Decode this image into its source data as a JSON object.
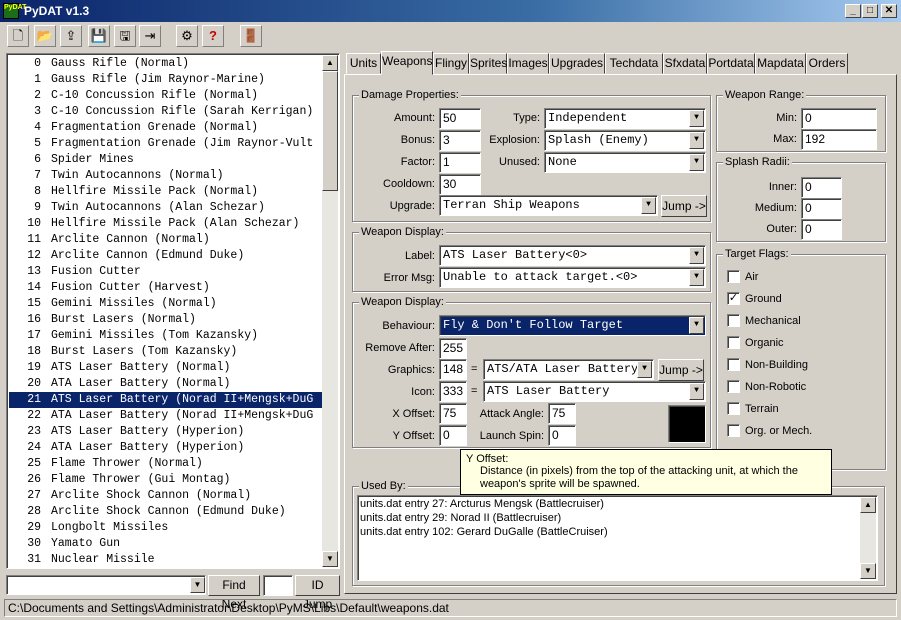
{
  "window": {
    "title": "PyDAT v1.3",
    "app_icon_text": "PyDAT"
  },
  "window_buttons": {
    "minimize": "_",
    "maximize": "□",
    "close": "✕"
  },
  "toolbar": {
    "new": "🗋",
    "open": "📂",
    "import": "⇪",
    "save": "💾",
    "save_as": "🖫",
    "export": "⇥",
    "settings": "⚙",
    "help": "?",
    "exit": "🚪"
  },
  "entries": [
    {
      "id": "0",
      "name": "Gauss Rifle (Normal)"
    },
    {
      "id": "1",
      "name": "Gauss Rifle (Jim Raynor-Marine)"
    },
    {
      "id": "2",
      "name": "C-10 Concussion Rifle (Normal)"
    },
    {
      "id": "3",
      "name": "C-10 Concussion Rifle (Sarah Kerrigan)"
    },
    {
      "id": "4",
      "name": "Fragmentation Grenade (Normal)"
    },
    {
      "id": "5",
      "name": "Fragmentation Grenade (Jim Raynor-Vult"
    },
    {
      "id": "6",
      "name": "Spider Mines"
    },
    {
      "id": "7",
      "name": "Twin Autocannons (Normal)"
    },
    {
      "id": "8",
      "name": "Hellfire Missile Pack (Normal)"
    },
    {
      "id": "9",
      "name": "Twin Autocannons (Alan Schezar)"
    },
    {
      "id": "10",
      "name": "Hellfire Missile Pack (Alan Schezar)"
    },
    {
      "id": "11",
      "name": "Arclite Cannon (Normal)"
    },
    {
      "id": "12",
      "name": "Arclite Cannon (Edmund Duke)"
    },
    {
      "id": "13",
      "name": "Fusion Cutter"
    },
    {
      "id": "14",
      "name": "Fusion Cutter (Harvest)"
    },
    {
      "id": "15",
      "name": "Gemini Missiles (Normal)"
    },
    {
      "id": "16",
      "name": "Burst Lasers (Normal)"
    },
    {
      "id": "17",
      "name": "Gemini Missiles (Tom Kazansky)"
    },
    {
      "id": "18",
      "name": "Burst Lasers (Tom Kazansky)"
    },
    {
      "id": "19",
      "name": "ATS Laser Battery (Normal)"
    },
    {
      "id": "20",
      "name": "ATA Laser Battery (Normal)"
    },
    {
      "id": "21",
      "name": "ATS Laser Battery (Norad II+Mengsk+DuG"
    },
    {
      "id": "22",
      "name": "ATA Laser Battery (Norad II+Mengsk+DuG"
    },
    {
      "id": "23",
      "name": "ATS Laser Battery (Hyperion)"
    },
    {
      "id": "24",
      "name": "ATA Laser Battery (Hyperion)"
    },
    {
      "id": "25",
      "name": "Flame Thrower (Normal)"
    },
    {
      "id": "26",
      "name": "Flame Thrower (Gui Montag)"
    },
    {
      "id": "27",
      "name": "Arclite Shock Cannon (Normal)"
    },
    {
      "id": "28",
      "name": "Arclite Shock Cannon (Edmund Duke)"
    },
    {
      "id": "29",
      "name": "Longbolt Missiles"
    },
    {
      "id": "30",
      "name": "Yamato Gun"
    },
    {
      "id": "31",
      "name": "Nuclear Missile"
    }
  ],
  "selected_index": 21,
  "bottom_bar": {
    "find_value": "",
    "find_next": "Find Next",
    "id_value": "",
    "id_jump": "ID Jump"
  },
  "tabs": [
    "Units",
    "Weapons",
    "Flingy",
    "Sprites",
    "Images",
    "Upgrades",
    "Techdata",
    "Sfxdata",
    "Portdata",
    "Mapdata",
    "Orders"
  ],
  "active_tab": "Weapons",
  "damage": {
    "title": "Damage Properties:",
    "amount_label": "Amount:",
    "amount": "50",
    "bonus_label": "Bonus:",
    "bonus": "3",
    "factor_label": "Factor:",
    "factor": "1",
    "cooldown_label": "Cooldown:",
    "cooldown": "30",
    "upgrade_label": "Upgrade:",
    "upgrade": "Terran Ship Weapons",
    "type_label": "Type:",
    "type": "Independent",
    "explosion_label": "Explosion:",
    "explosion": "Splash (Enemy)",
    "unused_label": "Unused:",
    "unused": "None",
    "jump": "Jump ->"
  },
  "display1": {
    "title": "Weapon Display:",
    "label_label": "Label:",
    "label": "ATS Laser Battery<0>",
    "error_label": "Error Msg:",
    "error": "Unable to attack target.<0>"
  },
  "display2": {
    "title": "Weapon Display:",
    "behaviour_label": "Behaviour:",
    "behaviour": "Fly & Don't Follow Target",
    "remove_label": "Remove After:",
    "remove": "255",
    "graphics_label": "Graphics:",
    "graphics": "148",
    "graphics_name": "ATS/ATA Laser Battery",
    "icon_label": "Icon:",
    "icon": "333",
    "icon_name": "ATS Laser Battery",
    "xoff_label": "X Offset:",
    "xoff": "75",
    "yoff_label": "Y Offset:",
    "yoff": "0",
    "angle_label": "Attack Angle:",
    "angle": "75",
    "spin_label": "Launch Spin:",
    "spin": "0",
    "eq": "=",
    "jump": "Jump ->"
  },
  "range": {
    "title": "Weapon Range:",
    "min_label": "Min:",
    "min": "0",
    "max_label": "Max:",
    "max": "192"
  },
  "splash": {
    "title": "Splash Radii:",
    "inner_label": "Inner:",
    "inner": "0",
    "medium_label": "Medium:",
    "medium": "0",
    "outer_label": "Outer:",
    "outer": "0"
  },
  "flags": {
    "title": "Target Flags:",
    "items": [
      {
        "label": "Air",
        "checked": false
      },
      {
        "label": "Ground",
        "checked": true
      },
      {
        "label": "Mechanical",
        "checked": false
      },
      {
        "label": "Organic",
        "checked": false
      },
      {
        "label": "Non-Building",
        "checked": false
      },
      {
        "label": "Non-Robotic",
        "checked": false
      },
      {
        "label": "Terrain",
        "checked": false
      },
      {
        "label": "Org. or Mech.",
        "checked": false
      }
    ],
    "check_mark": "✓"
  },
  "tooltip": {
    "title": "Y Offset:",
    "text": "Distance (in pixels) from the top of the attacking unit, at which the weapon's sprite will be spawned."
  },
  "used_by": {
    "title": "Used By:",
    "items": [
      "units.dat entry 27: Arcturus Mengsk (Battlecruiser)",
      "units.dat entry 29: Norad II (Battlecruiser)",
      "units.dat entry 102: Gerard DuGalle (BattleCruiser)"
    ]
  },
  "arrows": {
    "up": "▲",
    "down": "▼"
  },
  "status": "C:\\Documents and Settings\\Administrator\\Desktop\\PyMS\\Libs\\Default\\weapons.dat"
}
